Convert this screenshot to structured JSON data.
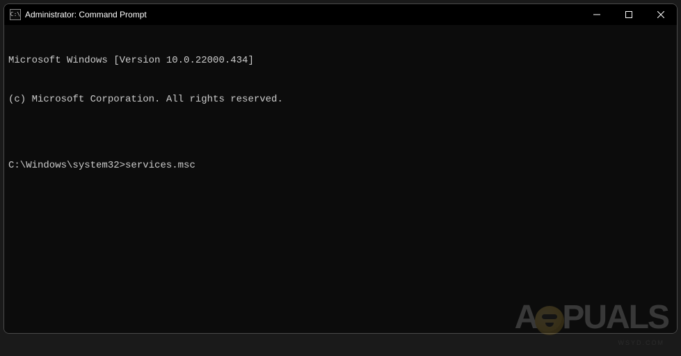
{
  "window": {
    "icon_text": "C:\\",
    "title": "Administrator: Command Prompt"
  },
  "terminal": {
    "line1": "Microsoft Windows [Version 10.0.22000.434]",
    "line2": "(c) Microsoft Corporation. All rights reserved.",
    "blank": "",
    "prompt": "C:\\Windows\\system32>",
    "command": "services.msc"
  },
  "watermark": {
    "left": "A",
    "right": "PUALS",
    "sub": "WSYD.COM"
  }
}
